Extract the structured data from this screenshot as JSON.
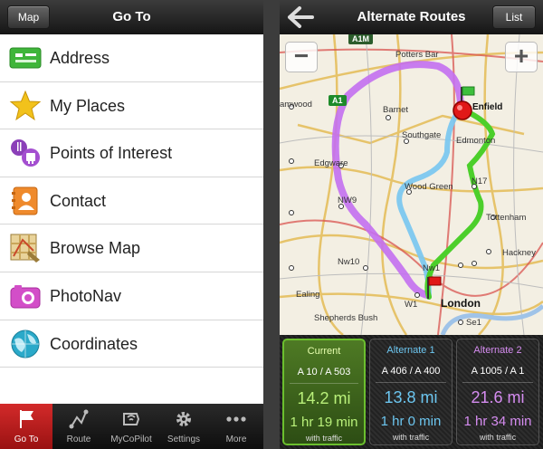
{
  "left_panel": {
    "header": {
      "map_button": "Map",
      "title": "Go To"
    },
    "menu": [
      {
        "label": "Address",
        "icon": "address-card-icon"
      },
      {
        "label": "My Places",
        "icon": "star-icon"
      },
      {
        "label": "Points of Interest",
        "icon": "poi-icon"
      },
      {
        "label": "Contact",
        "icon": "contact-book-icon"
      },
      {
        "label": "Browse Map",
        "icon": "browse-map-icon"
      },
      {
        "label": "PhotoNav",
        "icon": "camera-icon"
      },
      {
        "label": "Coordinates",
        "icon": "globe-icon"
      }
    ],
    "tabs": [
      {
        "label": "Go To",
        "icon": "flag-icon",
        "active": true
      },
      {
        "label": "Route",
        "icon": "route-icon",
        "active": false
      },
      {
        "label": "MyCoPilot",
        "icon": "mycopilot-icon",
        "active": false
      },
      {
        "label": "Settings",
        "icon": "gear-icon",
        "active": false
      },
      {
        "label": "More",
        "icon": "more-dots-icon",
        "active": false
      }
    ]
  },
  "right_panel": {
    "header": {
      "title": "Alternate Routes",
      "list_button": "List"
    },
    "map": {
      "zoom_out": "−",
      "zoom_in": "+",
      "road_labels": {
        "a1m": "A1M",
        "a1": "A1"
      },
      "places": {
        "potters_bar": "Potters Bar",
        "enfield": "Enfield",
        "barnet": "Barnet",
        "amwood": "amwood",
        "southgate": "Southgate",
        "edmonton": "Edmonton",
        "edgware": "Edgware",
        "wood_green": "Wood Green",
        "n17": "N17",
        "nw9": "NW9",
        "tottenham": "Tottenham",
        "nw10": "Nw10",
        "hackney": "Hackney",
        "nw1": "Nw1",
        "ealing": "Ealing",
        "london": "London",
        "shepherds_bush": "Shepherds Bush",
        "w1": "W1",
        "se1": "Se1"
      }
    },
    "routes": [
      {
        "name": "Current",
        "roads": "A 10 / A 503",
        "distance": "14.2 mi",
        "time": "1 hr 19 min",
        "note": "with traffic",
        "color": "#8fe04a"
      },
      {
        "name": "Alternate 1",
        "roads": "A 406 / A 400",
        "distance": "13.8 mi",
        "time": "1 hr 0 min",
        "note": "with traffic",
        "color": "#6cc6f0"
      },
      {
        "name": "Alternate 2",
        "roads": "A 1005 / A 1",
        "distance": "21.6 mi",
        "time": "1 hr 34 min",
        "note": "with traffic",
        "color": "#d58cf0"
      }
    ]
  }
}
